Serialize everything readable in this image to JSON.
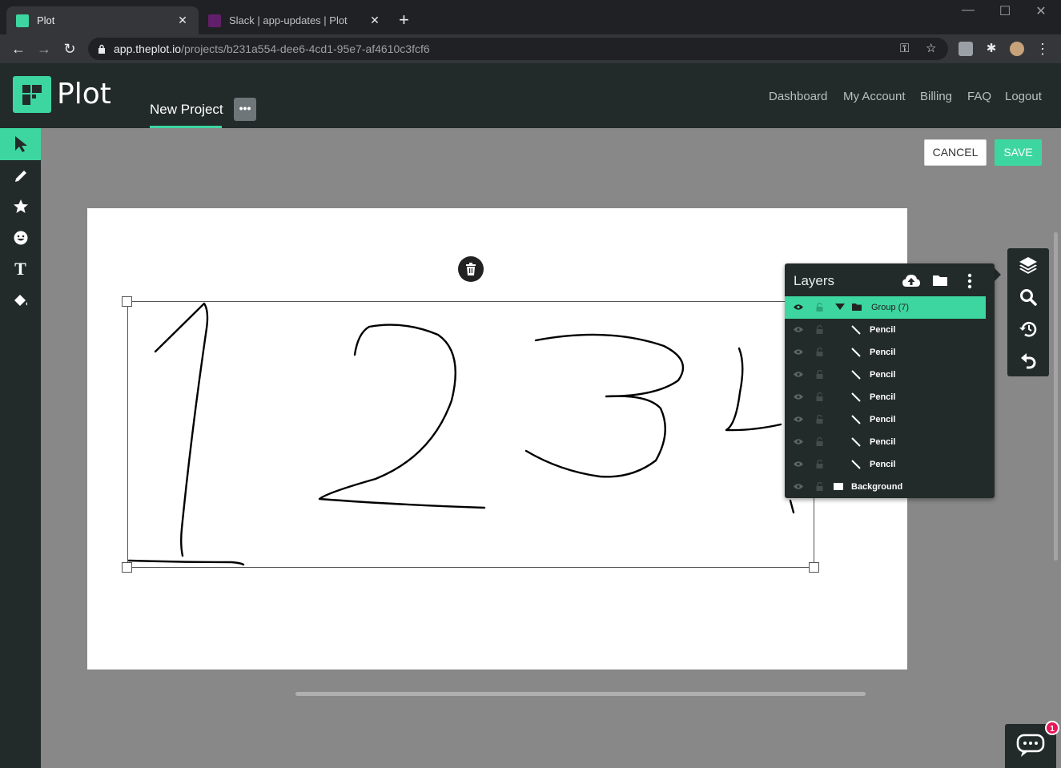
{
  "browser": {
    "tabs": [
      {
        "title": "Plot",
        "active": true
      },
      {
        "title": "Slack | app-updates | Plot",
        "active": false
      }
    ],
    "url_host": "app.theplot.io",
    "url_path": "/projects/b231a554-dee6-4cd1-95e7-af4610c3fcf6"
  },
  "header": {
    "logo_text": "Plot",
    "project_name": "New Project",
    "project_menu_label": "•••",
    "nav": [
      "Dashboard",
      "My Account",
      "Billing",
      "FAQ",
      "Logout"
    ]
  },
  "tools": [
    "select-arrow-icon",
    "pencil-icon",
    "star-icon",
    "emoji-icon",
    "text-icon",
    "paint-bucket-icon"
  ],
  "actions": {
    "cancel_label": "CANCEL",
    "save_label": "SAVE"
  },
  "canvas": {
    "drawing_text": "1234"
  },
  "layers": {
    "title": "Layers",
    "group_label": "Group",
    "group_count": "(7)",
    "items": [
      "Pencil",
      "Pencil",
      "Pencil",
      "Pencil",
      "Pencil",
      "Pencil",
      "Pencil"
    ],
    "background_label": "Background"
  },
  "right_tools": [
    "layers-icon",
    "search-icon",
    "history-icon",
    "undo-icon"
  ],
  "chat": {
    "badge_count": "1"
  },
  "colors": {
    "accent": "#3dd6a1",
    "header_bg": "#222b29",
    "workspace_bg": "#888888",
    "badge": "#e8185a"
  }
}
